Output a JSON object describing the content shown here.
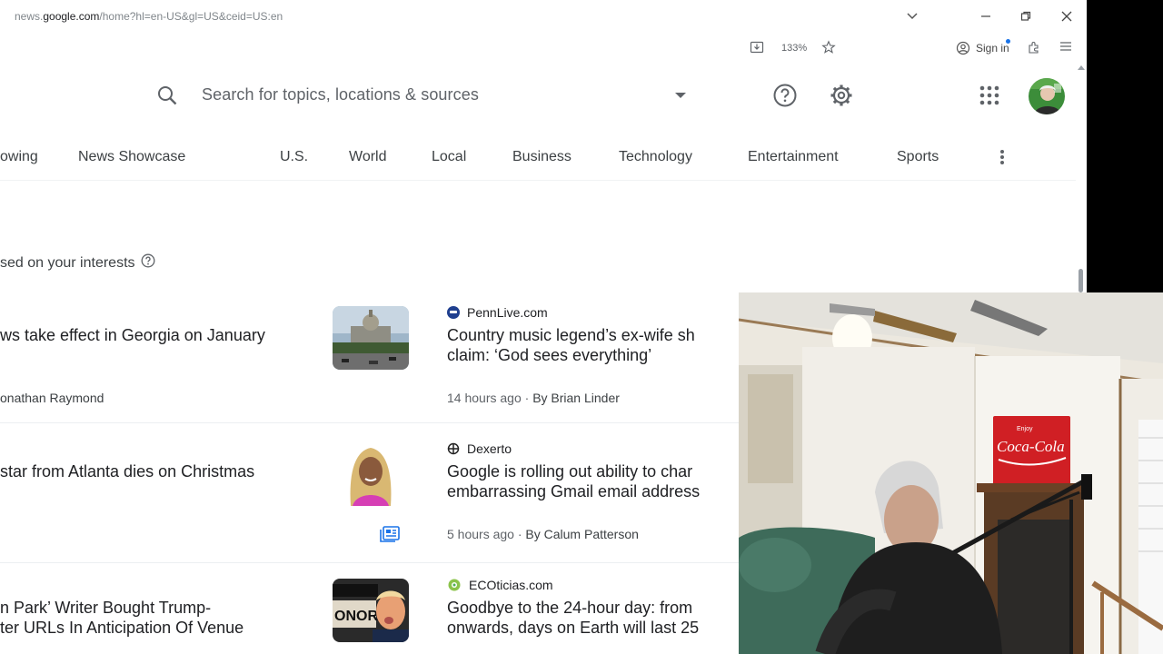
{
  "browser": {
    "url_prefix": "news.",
    "url_host": "google.com",
    "url_path": "/home?hl=en-US&gl=US&ceid=US:en",
    "zoom": "133%",
    "signin_label": "Sign in"
  },
  "search": {
    "placeholder": "Search for topics, locations & sources"
  },
  "tabs": [
    {
      "label": "owing"
    },
    {
      "label": "News Showcase"
    },
    {
      "label": "U.S."
    },
    {
      "label": "World"
    },
    {
      "label": "Local"
    },
    {
      "label": "Business"
    },
    {
      "label": "Technology"
    },
    {
      "label": "Entertainment"
    },
    {
      "label": "Sports"
    }
  ],
  "section": {
    "title": "sed on your interests"
  },
  "left_articles": [
    {
      "headline": "ws take effect in Georgia on January",
      "byline": "onathan Raymond"
    },
    {
      "headline": "star from Atlanta dies on Christmas"
    },
    {
      "headline_line1": "n Park’ Writer Bought Trump-",
      "headline_line2": "ter URLs In Anticipation Of Venue"
    }
  ],
  "right_articles": [
    {
      "source": "PennLive.com",
      "line1": "Country music legend’s ex-wife sh",
      "line2": "claim: ‘God sees everything’",
      "time": "14 hours ago",
      "by": "By Brian Linder"
    },
    {
      "source": "Dexerto",
      "line1": "Google is rolling out ability to char",
      "line2": "embarrassing Gmail email address",
      "time": "5 hours ago",
      "by": "By Calum Patterson"
    },
    {
      "source": "ECOticias.com",
      "line1": "Goodbye to the 24-hour day: from",
      "line2": "onwards, days on Earth will last 25"
    }
  ],
  "webcam": {
    "sign_small": "Enjoy",
    "sign_brand": "Coca-Cola"
  },
  "colors": {
    "accent": "#1a73e8",
    "text": "#202124",
    "muted": "#5f6368"
  }
}
